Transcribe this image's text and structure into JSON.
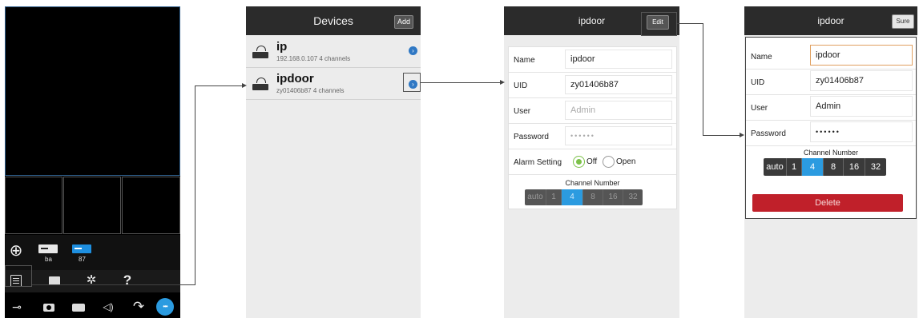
{
  "screen1": {
    "devices": [
      {
        "label": "ba"
      },
      {
        "label": "87"
      }
    ],
    "tabs": [
      {
        "icon": "device-list-icon"
      },
      {
        "icon": "folder-icon"
      },
      {
        "icon": "gear-icon"
      },
      {
        "icon": "help-icon",
        "glyph": "?"
      }
    ],
    "controls": [
      {
        "icon": "key-icon"
      },
      {
        "icon": "camera-icon"
      },
      {
        "icon": "video-record-icon"
      },
      {
        "icon": "speaker-icon"
      },
      {
        "icon": "phone-hangup-icon"
      },
      {
        "icon": "more-icon"
      }
    ],
    "glyphs": {
      "add": "⊕",
      "key": "⊸",
      "speaker": "◁)",
      "hangup": "↷",
      "more": "•••"
    }
  },
  "screen2": {
    "title": "Devices",
    "add_label": "Add",
    "devices": [
      {
        "name": "ip",
        "info": "192.168.0.107 4 channels"
      },
      {
        "name": "ipdoor",
        "info": "zy01406b87 4 channels"
      }
    ]
  },
  "screen3": {
    "title": "ipdoor",
    "edit_label": "Edit",
    "fields": [
      {
        "label": "Name",
        "value": "ipdoor"
      },
      {
        "label": "UID",
        "value": "zy01406b87"
      },
      {
        "label": "User",
        "value": "Admin"
      },
      {
        "label": "Password",
        "value": "••••••"
      }
    ],
    "alarm": {
      "label": "Alarm Setting",
      "off": "Off",
      "open": "Open"
    },
    "channel_label": "Channel Number",
    "channels": [
      "auto",
      "1",
      "4",
      "8",
      "16",
      "32"
    ],
    "selected_channel": "4"
  },
  "screen4": {
    "title": "ipdoor",
    "sure_label": "Sure",
    "fields": [
      {
        "label": "Name",
        "value": "ipdoor"
      },
      {
        "label": "UID",
        "value": "zy01406b87"
      },
      {
        "label": "User",
        "value": "Admin"
      },
      {
        "label": "Password",
        "value": "••••••"
      }
    ],
    "channel_label": "Channel Number",
    "channels": [
      "auto",
      "1",
      "4",
      "8",
      "16",
      "32"
    ],
    "selected_channel": "4",
    "delete_label": "Delete"
  },
  "colors": {
    "header": "#2b2b2b",
    "accent_blue": "#2b9be0",
    "delete_red": "#c0202a",
    "radio_green": "#7cc14a",
    "focus_orange": "#e0a060"
  }
}
